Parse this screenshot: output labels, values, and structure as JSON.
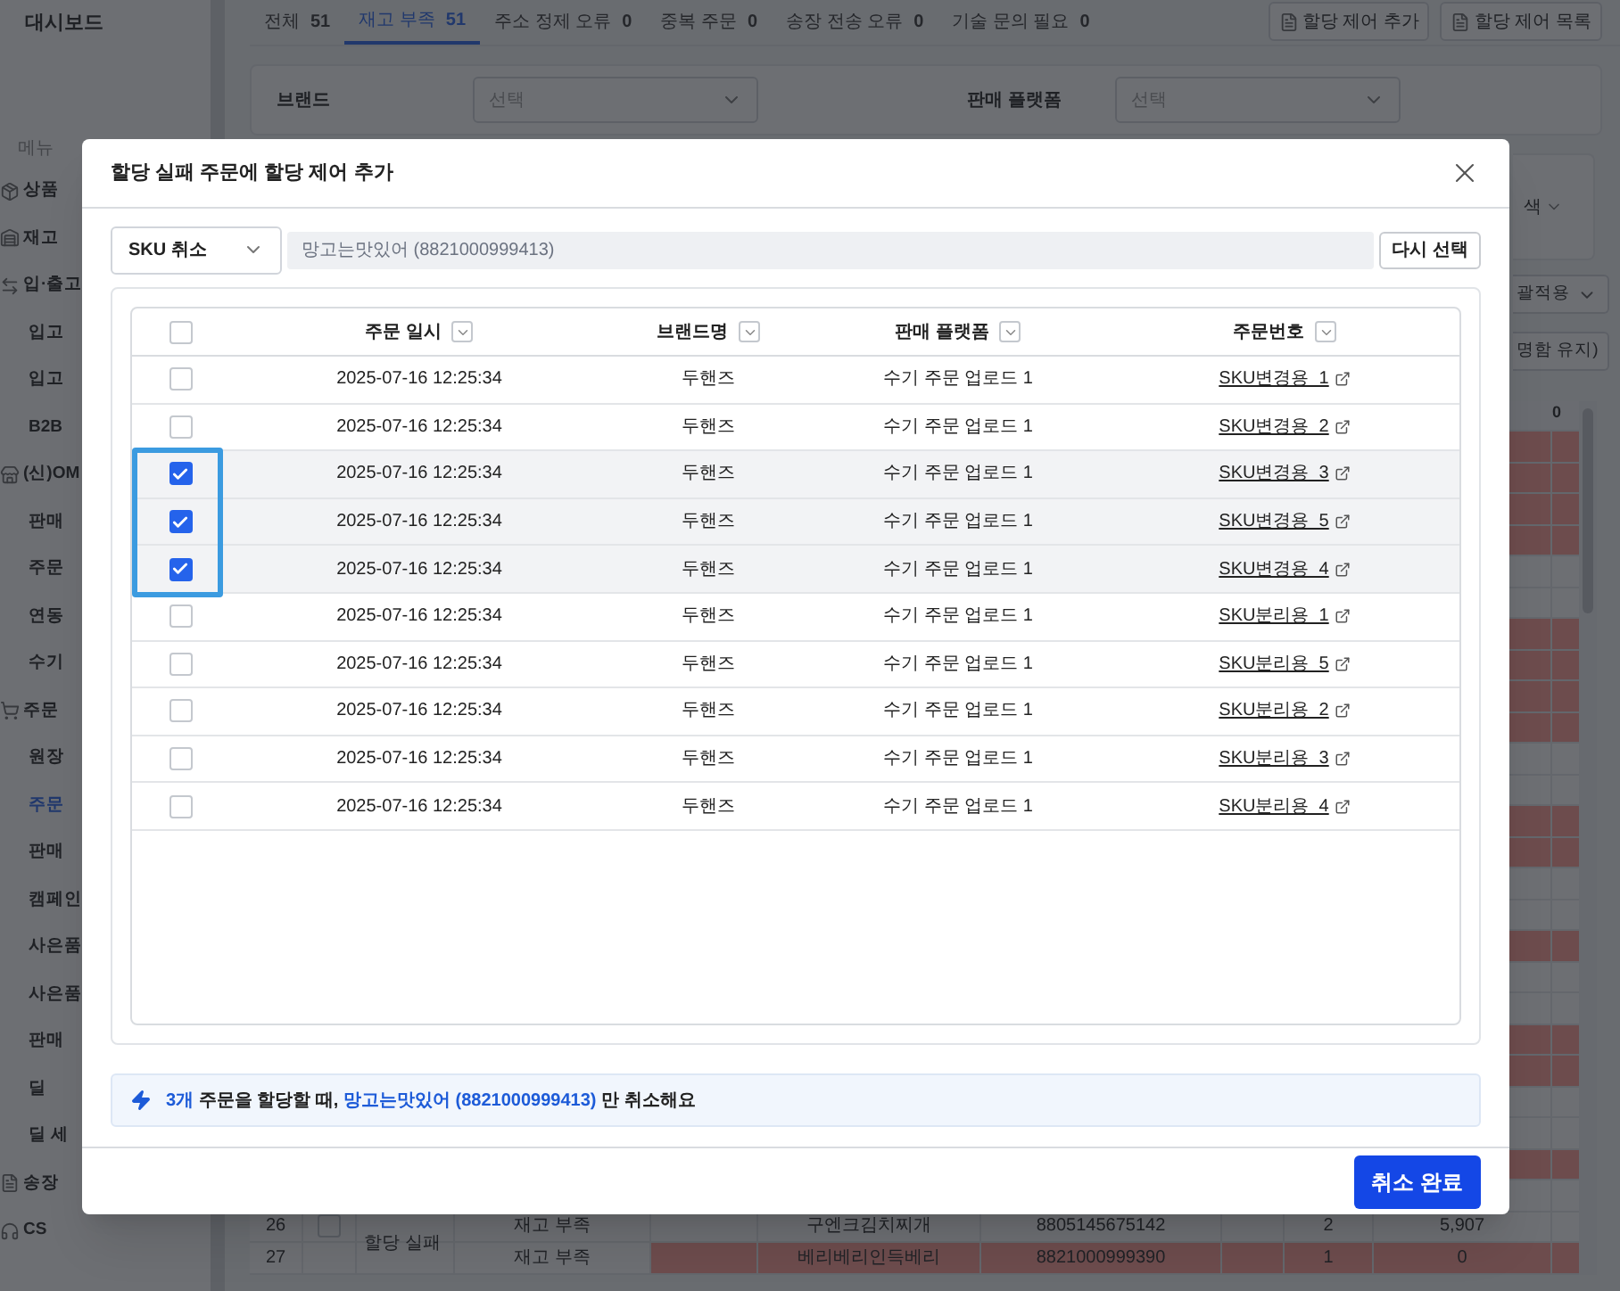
{
  "sidebar": {
    "top_item": "대시보드",
    "section_label": "메뉴",
    "items": [
      {
        "kind": "group",
        "label": "상품",
        "selected": false
      },
      {
        "kind": "group",
        "label": "재고",
        "selected": false
      },
      {
        "kind": "group",
        "label": "입·출고",
        "selected": false
      },
      {
        "kind": "item",
        "label": "입고",
        "selected": false
      },
      {
        "kind": "item",
        "label": "입고",
        "selected": false
      },
      {
        "kind": "item",
        "label": "B2B",
        "selected": false
      },
      {
        "kind": "group",
        "label": "(신)OM",
        "selected": false
      },
      {
        "kind": "item",
        "label": "판매",
        "selected": false
      },
      {
        "kind": "item",
        "label": "주문",
        "selected": false
      },
      {
        "kind": "item",
        "label": "연동",
        "selected": false
      },
      {
        "kind": "item",
        "label": "수기",
        "selected": false
      },
      {
        "kind": "group",
        "label": "주문",
        "selected": false
      },
      {
        "kind": "item",
        "label": "원장",
        "selected": false
      },
      {
        "kind": "item",
        "label": "주문",
        "selected": true
      },
      {
        "kind": "item",
        "label": "판매",
        "selected": false
      },
      {
        "kind": "item",
        "label": "캠페인",
        "selected": false
      },
      {
        "kind": "item",
        "label": "사은품",
        "selected": false
      },
      {
        "kind": "item",
        "label": "사은품",
        "selected": false
      },
      {
        "kind": "item",
        "label": "판매",
        "selected": false
      },
      {
        "kind": "item",
        "label": "딜",
        "selected": false
      },
      {
        "kind": "item",
        "label": "딜 세",
        "selected": false
      },
      {
        "kind": "group",
        "label": "송장",
        "selected": false
      },
      {
        "kind": "group",
        "label": "CS",
        "selected": false
      }
    ]
  },
  "tabs": [
    {
      "label": "전체",
      "count": "51",
      "selected": false
    },
    {
      "label": "재고 부족",
      "count": "51",
      "selected": true
    },
    {
      "label": "주소 정제 오류",
      "count": "0",
      "selected": false
    },
    {
      "label": "중복 주문",
      "count": "0",
      "selected": false
    },
    {
      "label": "송장 전송 오류",
      "count": "0",
      "selected": false
    },
    {
      "label": "기술 문의 필요",
      "count": "0",
      "selected": false
    }
  ],
  "header_buttons": [
    "할당 제어 추가",
    "할당 제어 목록"
  ],
  "filters": [
    {
      "label": "브랜드",
      "placeholder": "선택"
    },
    {
      "label": "판매 플랫폼",
      "placeholder": "선택"
    }
  ],
  "right_controls": [
    "색",
    "괄적용",
    "명함 유지)"
  ],
  "background_table": {
    "header_last": "0",
    "rows": [
      {
        "highlighted": true
      },
      {
        "highlighted": true
      },
      {
        "highlighted": true
      },
      {
        "highlighted": true
      },
      {
        "highlighted": false
      },
      {
        "highlighted": false
      },
      {
        "highlighted": true
      },
      {
        "highlighted": true
      },
      {
        "highlighted": true
      },
      {
        "highlighted": true
      },
      {
        "highlighted": false
      },
      {
        "highlighted": false
      },
      {
        "highlighted": true
      },
      {
        "highlighted": true
      },
      {
        "highlighted": false
      },
      {
        "highlighted": false
      },
      {
        "highlighted": true
      },
      {
        "highlighted": false
      },
      {
        "highlighted": false
      },
      {
        "highlighted": true
      },
      {
        "highlighted": true
      },
      {
        "highlighted": false
      },
      {
        "highlighted": false
      },
      {
        "highlighted": true
      },
      {
        "highlighted": false
      },
      {
        "highlighted": false,
        "number": "26",
        "checked": false,
        "group": "할당 실패",
        "reason": "재고 부족",
        "product": "구엔크김치찌개",
        "barcode": "8805145675142",
        "qty": "2",
        "value": "5,907"
      },
      {
        "highlighted": true,
        "number": "27",
        "reason": "재고 부족",
        "product": "베리베리인득베리",
        "barcode": "8821000999390",
        "qty": "1",
        "value": "0"
      }
    ]
  },
  "modal": {
    "title": "할당 실패 주문에 할당 제어 추가",
    "action_select": "SKU 취소",
    "product_field": "망고는맛있어 (8821000999413)",
    "reselect_button": "다시 선택",
    "columns": [
      "주문 일시",
      "브랜드명",
      "판매 플랫폼",
      "주문번호"
    ],
    "header_checked": false,
    "rows": [
      {
        "checked": false,
        "date": "2025-07-16 12:25:34",
        "brand": "두핸즈",
        "platform": "수기 주문 업로드 1",
        "order": "SKU변경용_1"
      },
      {
        "checked": false,
        "date": "2025-07-16 12:25:34",
        "brand": "두핸즈",
        "platform": "수기 주문 업로드 1",
        "order": "SKU변경용_2"
      },
      {
        "checked": true,
        "date": "2025-07-16 12:25:34",
        "brand": "두핸즈",
        "platform": "수기 주문 업로드 1",
        "order": "SKU변경용_3"
      },
      {
        "checked": true,
        "date": "2025-07-16 12:25:34",
        "brand": "두핸즈",
        "platform": "수기 주문 업로드 1",
        "order": "SKU변경용_5"
      },
      {
        "checked": true,
        "date": "2025-07-16 12:25:34",
        "brand": "두핸즈",
        "platform": "수기 주문 업로드 1",
        "order": "SKU변경용_4"
      },
      {
        "checked": false,
        "date": "2025-07-16 12:25:34",
        "brand": "두핸즈",
        "platform": "수기 주문 업로드 1",
        "order": "SKU분리용_1"
      },
      {
        "checked": false,
        "date": "2025-07-16 12:25:34",
        "brand": "두핸즈",
        "platform": "수기 주문 업로드 1",
        "order": "SKU분리용_5"
      },
      {
        "checked": false,
        "date": "2025-07-16 12:25:34",
        "brand": "두핸즈",
        "platform": "수기 주문 업로드 1",
        "order": "SKU분리용_2"
      },
      {
        "checked": false,
        "date": "2025-07-16 12:25:34",
        "brand": "두핸즈",
        "platform": "수기 주문 업로드 1",
        "order": "SKU분리용_3"
      },
      {
        "checked": false,
        "date": "2025-07-16 12:25:34",
        "brand": "두핸즈",
        "platform": "수기 주문 업로드 1",
        "order": "SKU분리용_4"
      }
    ],
    "notice": [
      {
        "text": "3개",
        "highlight": true
      },
      {
        "text": " 주문을 할당할 때, ",
        "highlight": false
      },
      {
        "text": "망고는맛있어 (8821000999413)",
        "highlight": true
      },
      {
        "text": " 만 취소해요",
        "highlight": false
      }
    ],
    "confirm_button": "취소 완료"
  }
}
